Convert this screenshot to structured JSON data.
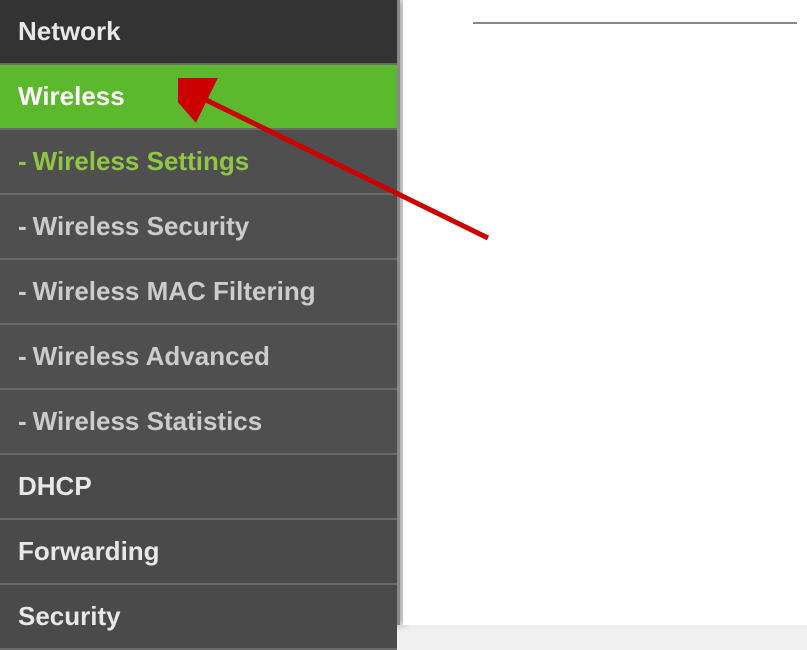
{
  "sidebar": {
    "items": [
      {
        "label": "Network",
        "type": "main",
        "classes": "dark"
      },
      {
        "label": "Wireless",
        "type": "main",
        "classes": "active"
      },
      {
        "label": "Wireless Settings",
        "type": "sub",
        "classes": "selected"
      },
      {
        "label": "Wireless Security",
        "type": "sub",
        "classes": ""
      },
      {
        "label": "Wireless MAC Filtering",
        "type": "sub",
        "classes": ""
      },
      {
        "label": "Wireless Advanced",
        "type": "sub",
        "classes": ""
      },
      {
        "label": "Wireless Statistics",
        "type": "sub",
        "classes": ""
      },
      {
        "label": "DHCP",
        "type": "main",
        "classes": ""
      },
      {
        "label": "Forwarding",
        "type": "main",
        "classes": ""
      },
      {
        "label": "Security",
        "type": "main",
        "classes": ""
      }
    ],
    "sub_prefix": "-"
  }
}
